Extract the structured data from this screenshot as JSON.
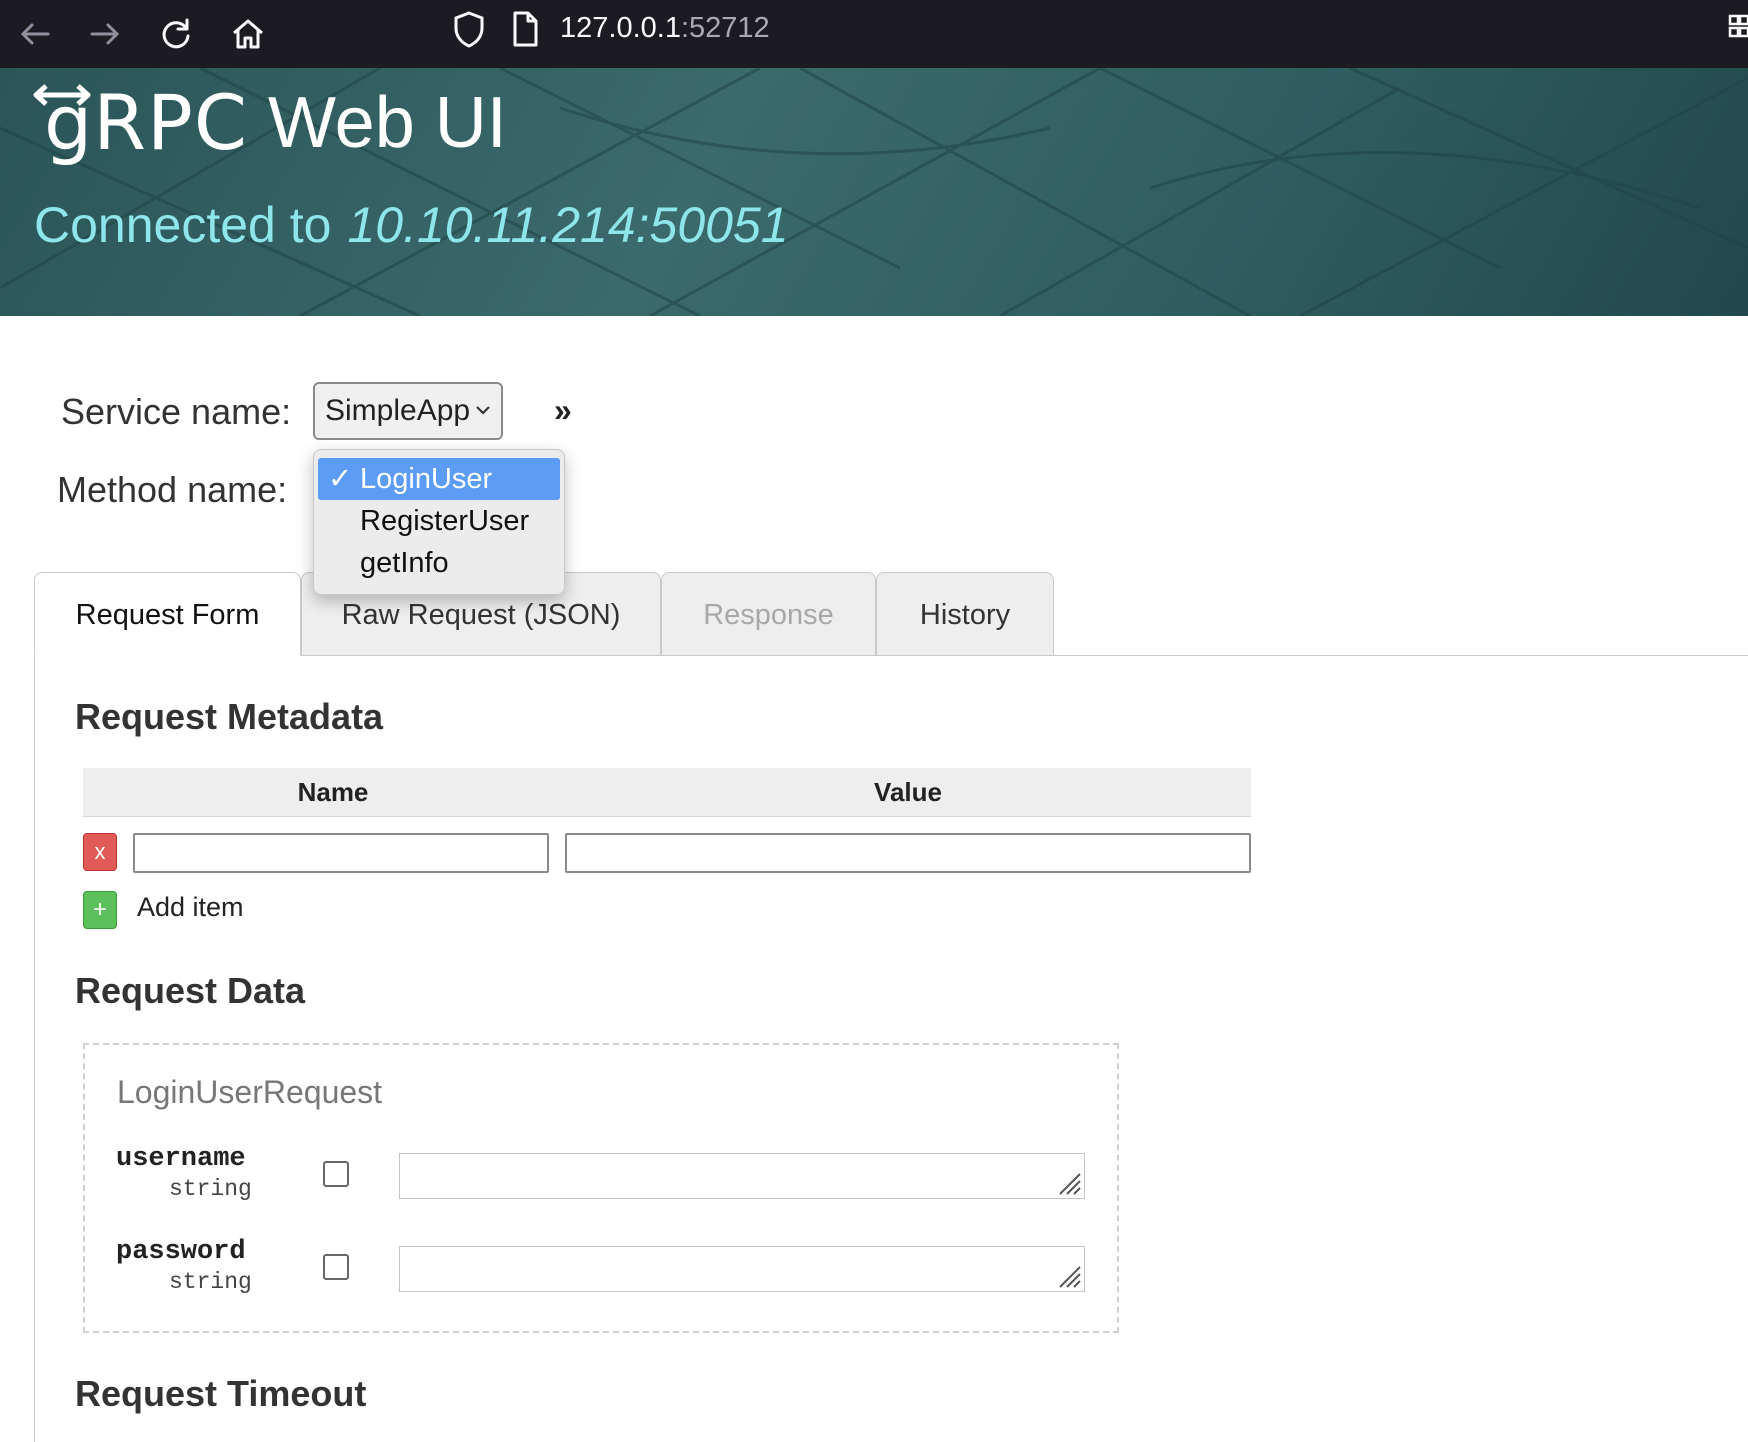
{
  "browser": {
    "url_host": "127.0.0.1",
    "url_port": ":52712",
    "icons": [
      "back-arrow-icon",
      "forward-arrow-icon",
      "reload-icon",
      "home-icon",
      "shield-icon",
      "page-icon",
      "extensions-icon"
    ]
  },
  "header": {
    "logo_text": "gRPC",
    "app_title": "Web UI",
    "connected_label": "Connected to",
    "connected_host": "10.10.11.214:50051"
  },
  "form": {
    "service_label": "Service name:",
    "service_selected": "SimpleApp",
    "method_label": "Method name:",
    "method_options": [
      {
        "label": "LoginUser",
        "selected": true
      },
      {
        "label": "RegisterUser",
        "selected": false
      },
      {
        "label": "getInfo",
        "selected": false
      }
    ]
  },
  "tabs": [
    {
      "label": "Request Form",
      "state": "active"
    },
    {
      "label": "Raw Request (JSON)",
      "state": "normal"
    },
    {
      "label": "Response",
      "state": "disabled"
    },
    {
      "label": "History",
      "state": "normal"
    }
  ],
  "metadata": {
    "title": "Request Metadata",
    "col_name": "Name",
    "col_value": "Value",
    "remove_label": "x",
    "add_symbol": "+",
    "add_label": "Add item",
    "row": {
      "name": "",
      "value": ""
    }
  },
  "request_data": {
    "title": "Request Data",
    "message_name": "LoginUserRequest",
    "fields": [
      {
        "name": "username",
        "type": "string",
        "value": ""
      },
      {
        "name": "password",
        "type": "string",
        "value": ""
      }
    ]
  },
  "timeout": {
    "title": "Request Timeout"
  },
  "colors": {
    "banner": "#2f5d60",
    "connected_text": "#8fe6ea",
    "dropdown_selected": "#5c9cf5",
    "remove_button": "#e05a57",
    "add_button": "#5cc15a"
  }
}
